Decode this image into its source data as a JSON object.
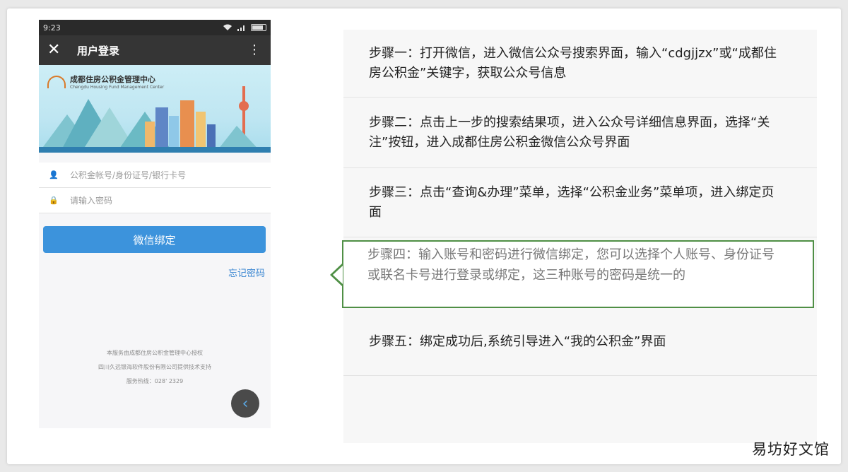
{
  "phone": {
    "status_time": "9:23",
    "nav_title": "用户登录",
    "close_icon": "close-icon",
    "more_icon": "more-vertical-icon",
    "banner_logo_main": "成都住房公积金管理中心",
    "banner_logo_sub": "Chengdu Housing Fund Management Center",
    "account_placeholder": "公积金帐号/身份证号/银行卡号",
    "password_placeholder": "请输入密码",
    "bind_button": "微信绑定",
    "forgot_link": "忘记密码",
    "footer_line1": "本服务由成都住房公积金管理中心授权",
    "footer_line2": "四川久远银海软件股份有限公司提供技术支持",
    "footer_line3": "服务热线：028' 2329"
  },
  "steps": {
    "step1": "步骤一：打开微信，进入微信公众号搜索界面，输入“cdgjjzx”或“成都住房公积金”关键字，获取公众号信息",
    "step2": "步骤二：点击上一步的搜索结果项，进入公众号详细信息界面，选择“关注”按钮，进入成都住房公积金微信公众号界面",
    "step3": "步骤三：点击“查询&办理”菜单，选择“公积金业务”菜单项，进入绑定页面",
    "step4": "步骤四：输入账号和密码进行微信绑定，您可以选择个人账号、身份证号或联名卡号进行登录或绑定，这三种账号的密码是统一的",
    "step5": "步骤五：绑定成功后,系统引导进入“我的公积金”界面"
  },
  "watermark": "易坊好文馆",
  "colors": {
    "accent_blue": "#3c93dc",
    "highlight_green": "#4f8f45",
    "titlebar": "#353535"
  }
}
